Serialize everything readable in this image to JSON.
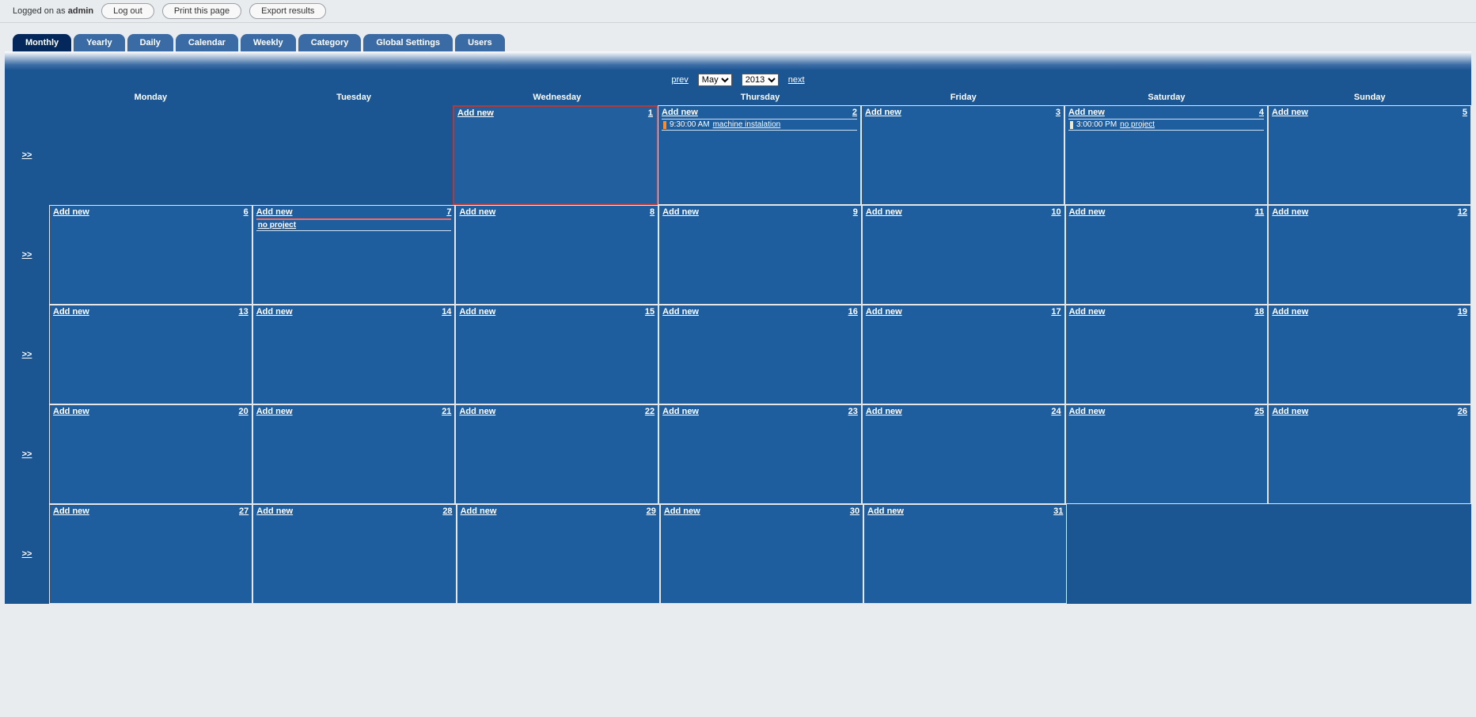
{
  "header": {
    "logged_prefix": "Logged on as ",
    "username": "admin",
    "logout": "Log out",
    "print": "Print this page",
    "export": "Export results"
  },
  "tabs": [
    {
      "label": "Monthly",
      "active": true
    },
    {
      "label": "Yearly",
      "active": false
    },
    {
      "label": "Daily",
      "active": false
    },
    {
      "label": "Calendar",
      "active": false
    },
    {
      "label": "Weekly",
      "active": false
    },
    {
      "label": "Category",
      "active": false
    },
    {
      "label": "Global Settings",
      "active": false
    },
    {
      "label": "Users",
      "active": false
    }
  ],
  "nav": {
    "prev": "prev",
    "next": "next",
    "month": "May",
    "year": "2013"
  },
  "day_names": [
    "Monday",
    "Tuesday",
    "Wednesday",
    "Thursday",
    "Friday",
    "Saturday",
    "Sunday"
  ],
  "add_new_label": "Add new",
  "week_link": ">>",
  "weeks": [
    {
      "cells": [
        {
          "empty": true
        },
        {
          "empty": true
        },
        {
          "num": "1",
          "today": true,
          "events": []
        },
        {
          "num": "2",
          "events": [
            {
              "type": "timed",
              "bar": "orange",
              "time": "9:30:00 AM",
              "title": "machine instalation"
            }
          ]
        },
        {
          "num": "3",
          "events": []
        },
        {
          "num": "4",
          "events": [
            {
              "type": "timed",
              "bar": "cream",
              "time": "3:00:00 PM",
              "title": "no project"
            }
          ]
        },
        {
          "num": "5",
          "events": []
        }
      ]
    },
    {
      "cells": [
        {
          "num": "6",
          "events": []
        },
        {
          "num": "7",
          "events": [
            {
              "type": "full",
              "title": "no project"
            }
          ]
        },
        {
          "num": "8",
          "events": []
        },
        {
          "num": "9",
          "events": []
        },
        {
          "num": "10",
          "events": []
        },
        {
          "num": "11",
          "events": []
        },
        {
          "num": "12",
          "events": []
        }
      ]
    },
    {
      "cells": [
        {
          "num": "13",
          "events": []
        },
        {
          "num": "14",
          "events": []
        },
        {
          "num": "15",
          "events": []
        },
        {
          "num": "16",
          "events": []
        },
        {
          "num": "17",
          "events": []
        },
        {
          "num": "18",
          "events": []
        },
        {
          "num": "19",
          "events": []
        }
      ]
    },
    {
      "cells": [
        {
          "num": "20",
          "events": []
        },
        {
          "num": "21",
          "events": []
        },
        {
          "num": "22",
          "events": []
        },
        {
          "num": "23",
          "events": []
        },
        {
          "num": "24",
          "events": []
        },
        {
          "num": "25",
          "events": []
        },
        {
          "num": "26",
          "events": []
        }
      ]
    },
    {
      "cells": [
        {
          "num": "27",
          "events": []
        },
        {
          "num": "28",
          "events": []
        },
        {
          "num": "29",
          "events": []
        },
        {
          "num": "30",
          "events": []
        },
        {
          "num": "31",
          "events": []
        },
        {
          "empty": true
        },
        {
          "empty": true
        }
      ]
    }
  ]
}
